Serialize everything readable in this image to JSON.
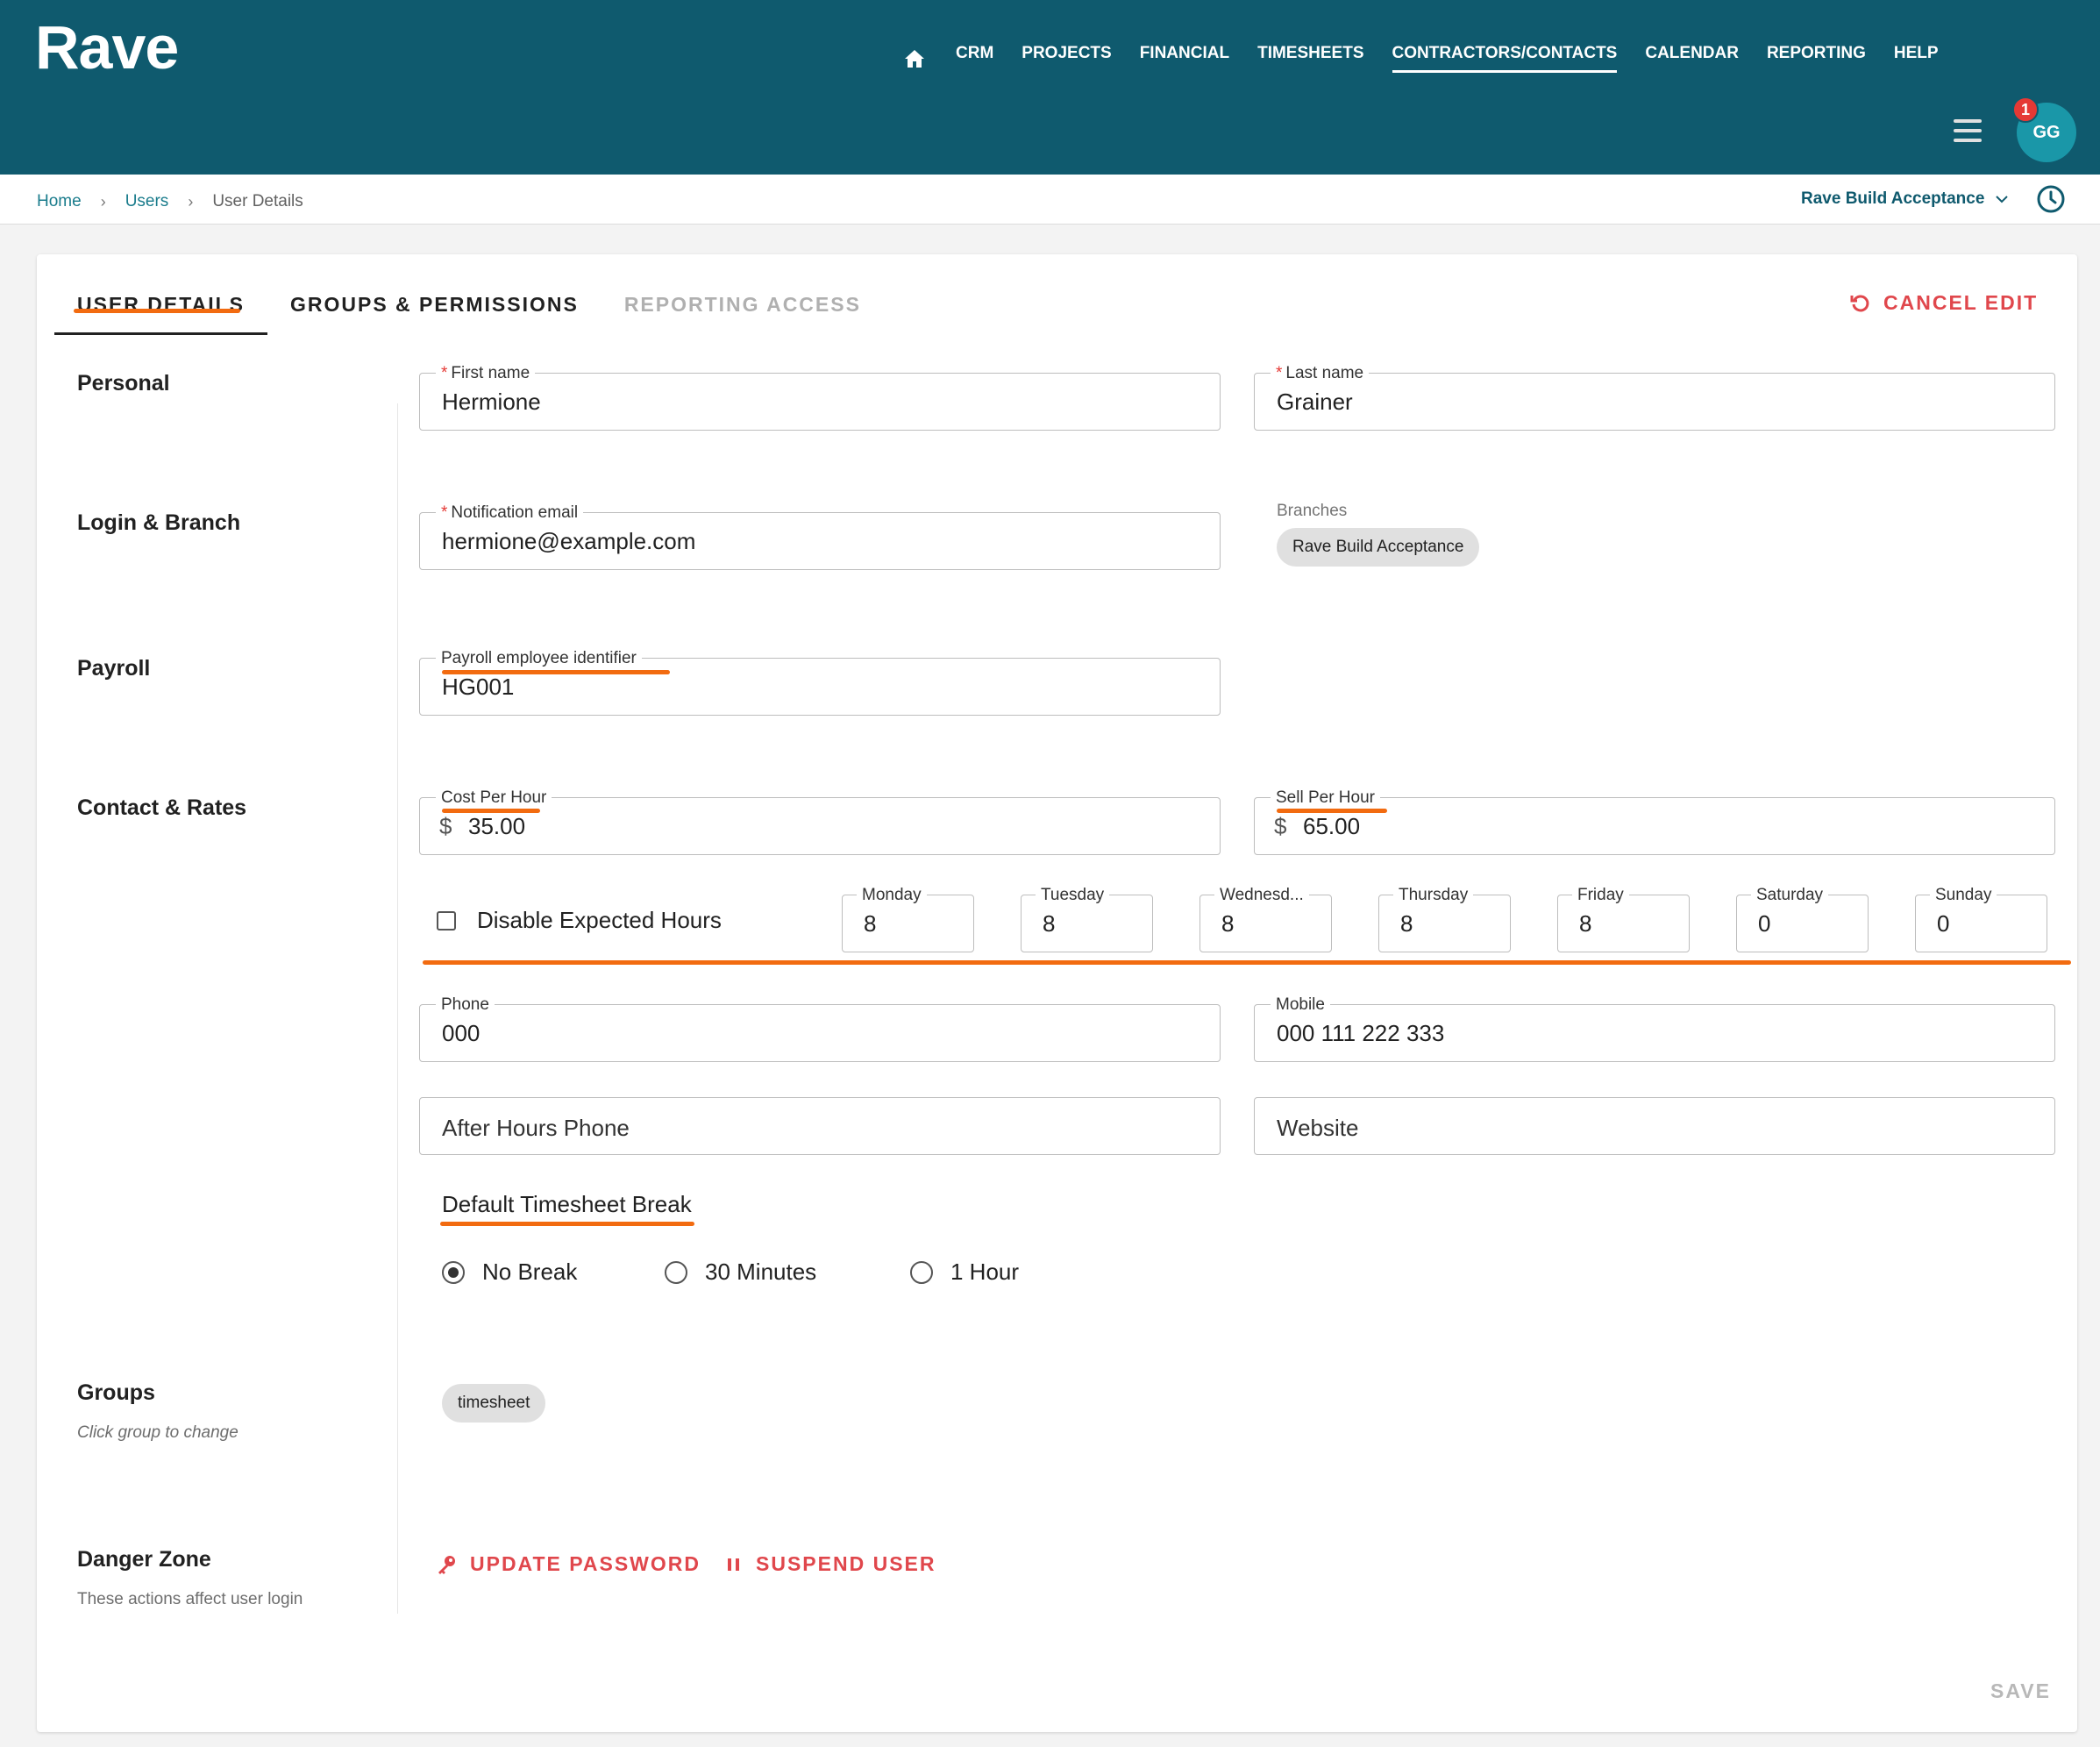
{
  "app": {
    "logo": "Rave"
  },
  "nav": {
    "items": [
      "CRM",
      "PROJECTS",
      "FINANCIAL",
      "TIMESHEETS",
      "CONTRACTORS/CONTACTS",
      "CALENDAR",
      "REPORTING",
      "HELP"
    ],
    "active": "CONTRACTORS/CONTACTS"
  },
  "user": {
    "initials": "GG",
    "notifications": "1"
  },
  "breadcrumb": {
    "home": "Home",
    "users": "Users",
    "current": "User Details"
  },
  "branch_selector": {
    "selected": "Rave Build Acceptance"
  },
  "tabs": {
    "user_details": "USER DETAILS",
    "groups_permissions": "GROUPS & PERMISSIONS",
    "reporting_access": "REPORTING ACCESS"
  },
  "cancel_edit": "CANCEL EDIT",
  "sections": {
    "personal": "Personal",
    "login_branch": "Login & Branch",
    "payroll": "Payroll",
    "contact_rates": "Contact & Rates",
    "groups": "Groups",
    "groups_sub": "Click group to change",
    "danger": "Danger Zone",
    "danger_sub": "These actions affect user login"
  },
  "fields": {
    "first_name": {
      "label": "First name",
      "required": "*",
      "value": "Hermione"
    },
    "last_name": {
      "label": "Last name",
      "required": "*",
      "value": "Grainer"
    },
    "email": {
      "label": "Notification email",
      "required": "*",
      "value": "hermione@example.com"
    },
    "branches": {
      "label": "Branches",
      "chip": "Rave Build Acceptance"
    },
    "payroll_id": {
      "label": "Payroll employee identifier",
      "value": "HG001"
    },
    "cost_per_hour": {
      "label": "Cost Per Hour",
      "prefix": "$",
      "value": "35.00"
    },
    "sell_per_hour": {
      "label": "Sell Per Hour",
      "prefix": "$",
      "value": "65.00"
    },
    "phone": {
      "label": "Phone",
      "value": "000"
    },
    "mobile": {
      "label": "Mobile",
      "value": "000 111 222 333"
    },
    "after_hours_phone": {
      "placeholder": "After Hours Phone"
    },
    "website": {
      "placeholder": "Website"
    }
  },
  "expected_hours": {
    "disable_label": "Disable Expected Hours",
    "days": [
      {
        "label": "Monday",
        "value": "8"
      },
      {
        "label": "Tuesday",
        "value": "8"
      },
      {
        "label": "Wednesd...",
        "value": "8"
      },
      {
        "label": "Thursday",
        "value": "8"
      },
      {
        "label": "Friday",
        "value": "8"
      },
      {
        "label": "Saturday",
        "value": "0"
      },
      {
        "label": "Sunday",
        "value": "0"
      }
    ]
  },
  "timesheet_break": {
    "title": "Default Timesheet Break",
    "options": [
      "No Break",
      "30 Minutes",
      "1 Hour"
    ],
    "selected": "No Break"
  },
  "groups": {
    "chip": "timesheet"
  },
  "danger_actions": {
    "update_password": "UPDATE PASSWORD",
    "suspend_user": "SUSPEND USER"
  },
  "save": "SAVE",
  "colors": {
    "header": "#0f5a6e",
    "danger": "#e0474c",
    "annotation": "#f26b10",
    "avatar": "#1a97a8"
  }
}
